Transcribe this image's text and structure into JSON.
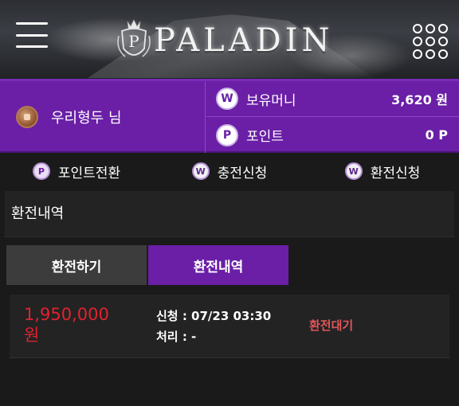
{
  "header": {
    "brand": "PALADIN",
    "logo_letter": "P"
  },
  "user": {
    "name": "우리형두 님"
  },
  "balance": {
    "money_icon": "W",
    "money_label": "보유머니",
    "money_value": "3,620 원",
    "point_icon": "P",
    "point_label": "포인트",
    "point_value": "0 P"
  },
  "actions": [
    {
      "label": "포인트전환",
      "icon": "P"
    },
    {
      "label": "충전신청",
      "icon": "W"
    },
    {
      "label": "환전신청",
      "icon": "W"
    }
  ],
  "section": {
    "title": "환전내역"
  },
  "tabs": [
    {
      "label": "환전하기",
      "active": false
    },
    {
      "label": "환전내역",
      "active": true
    }
  ],
  "history": [
    {
      "amount": "1,950,000",
      "currency": "원",
      "requested": "신청 : 07/23 03:30",
      "processed": "처리 : -",
      "status": "환전대기"
    }
  ],
  "colors": {
    "accent": "#6a1fa6",
    "amount_red": "#e1222f",
    "status_red": "#e0565a",
    "background": "#1a1a1a"
  }
}
